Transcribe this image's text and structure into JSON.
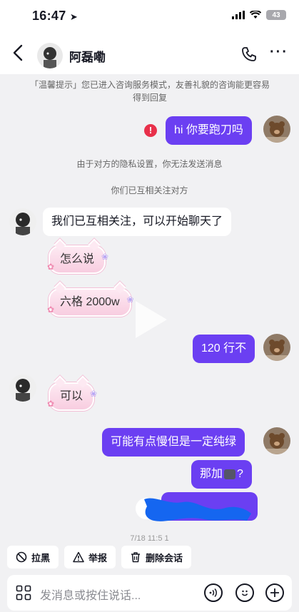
{
  "status": {
    "time": "16:47",
    "battery": "43"
  },
  "header": {
    "title": "阿磊嘞"
  },
  "notice": "「温馨提示」您已进入咨询服务模式，友善礼貌的咨询能更容易得到回复",
  "messages": {
    "m1": "hi 你要跑刀吗",
    "sys1": "由于对方的隐私设置，你无法发送消息",
    "sys2": "你们已互相关注对方",
    "m2": "我们已互相关注，可以开始聊天了",
    "m3": "怎么说",
    "m4": "六格 2000w",
    "m5": "120 行不",
    "m6": "可以",
    "m7": "可能有点慢但是一定纯绿",
    "m8": "那加",
    "m8_tail": "?"
  },
  "timestamp": "7/18 11:5 1",
  "actions": {
    "block": "拉黑",
    "report": "举报",
    "delete": "删除会话"
  },
  "input": {
    "placeholder": "发消息或按住说话..."
  },
  "colors": {
    "accent": "#6b3ff2",
    "error": "#e8304a",
    "sticker": "#fde9f2"
  },
  "icons": {
    "back": "chevron-left-icon",
    "phone": "phone-icon",
    "more": "more-icon",
    "error": "error-icon",
    "block": "block-icon",
    "report": "warning-icon",
    "delete": "trash-icon",
    "apps": "grid-icon",
    "voice": "voice-icon",
    "emoji": "emoji-icon",
    "plus": "plus-icon"
  }
}
